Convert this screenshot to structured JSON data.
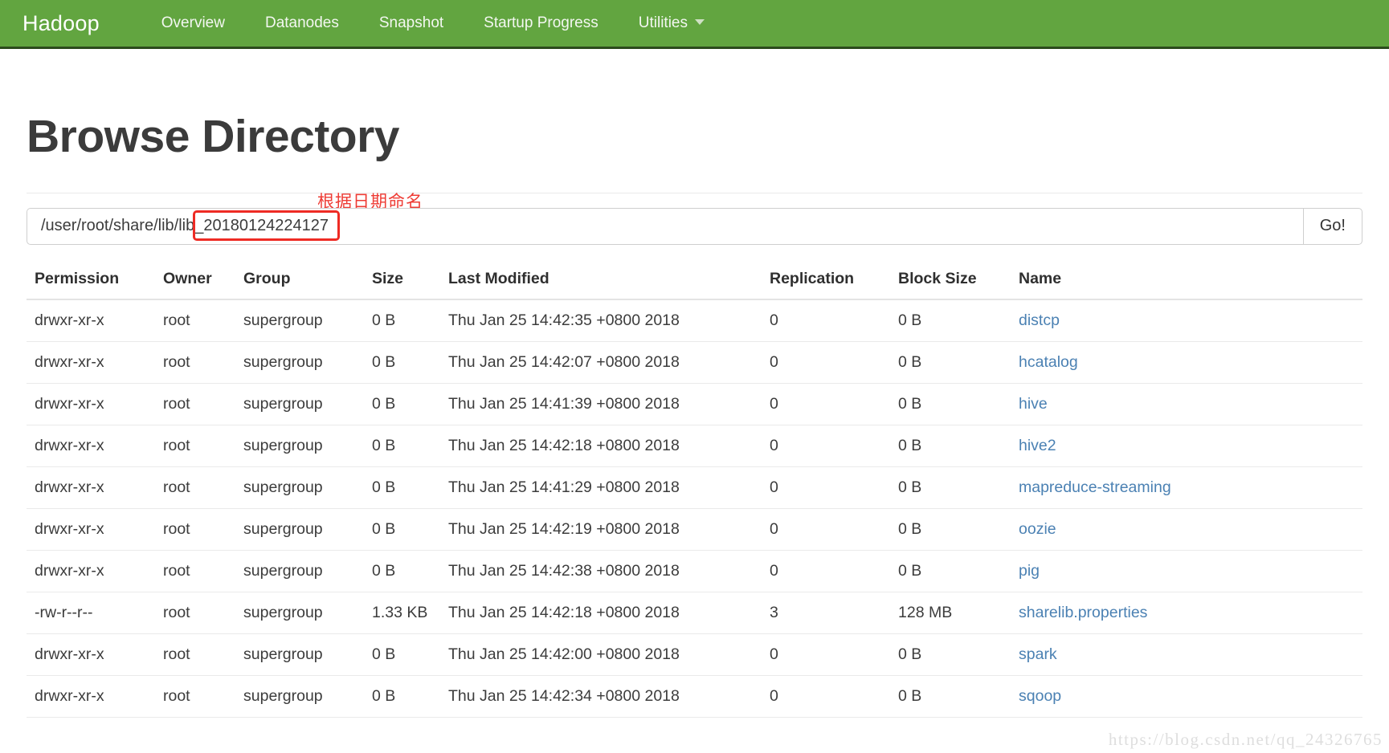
{
  "navbar": {
    "brand": "Hadoop",
    "accent_color": "#62a540",
    "items": [
      {
        "label": "Overview",
        "caret": false
      },
      {
        "label": "Datanodes",
        "caret": false
      },
      {
        "label": "Snapshot",
        "caret": false
      },
      {
        "label": "Startup Progress",
        "caret": false
      },
      {
        "label": "Utilities",
        "caret": true
      }
    ]
  },
  "page": {
    "title": "Browse Directory",
    "annotation": "根据日期命名",
    "annotation_color": "#ee3b34",
    "watermark": "https://blog.csdn.net/qq_24326765"
  },
  "path_bar": {
    "value": "/user/root/share/lib/lib_20180124224127",
    "placeholder": "Enter path",
    "highlighted_segment": "lib_20180124224127",
    "highlight_color": "#ee2b24",
    "go_label": "Go!"
  },
  "table": {
    "headers": [
      "Permission",
      "Owner",
      "Group",
      "Size",
      "Last Modified",
      "Replication",
      "Block Size",
      "Name"
    ],
    "rows": [
      {
        "permission": "drwxr-xr-x",
        "owner": "root",
        "group": "supergroup",
        "size": "0 B",
        "modified": "Thu Jan 25 14:42:35 +0800 2018",
        "replication": "0",
        "block_size": "0 B",
        "name": "distcp"
      },
      {
        "permission": "drwxr-xr-x",
        "owner": "root",
        "group": "supergroup",
        "size": "0 B",
        "modified": "Thu Jan 25 14:42:07 +0800 2018",
        "replication": "0",
        "block_size": "0 B",
        "name": "hcatalog"
      },
      {
        "permission": "drwxr-xr-x",
        "owner": "root",
        "group": "supergroup",
        "size": "0 B",
        "modified": "Thu Jan 25 14:41:39 +0800 2018",
        "replication": "0",
        "block_size": "0 B",
        "name": "hive"
      },
      {
        "permission": "drwxr-xr-x",
        "owner": "root",
        "group": "supergroup",
        "size": "0 B",
        "modified": "Thu Jan 25 14:42:18 +0800 2018",
        "replication": "0",
        "block_size": "0 B",
        "name": "hive2"
      },
      {
        "permission": "drwxr-xr-x",
        "owner": "root",
        "group": "supergroup",
        "size": "0 B",
        "modified": "Thu Jan 25 14:41:29 +0800 2018",
        "replication": "0",
        "block_size": "0 B",
        "name": "mapreduce-streaming"
      },
      {
        "permission": "drwxr-xr-x",
        "owner": "root",
        "group": "supergroup",
        "size": "0 B",
        "modified": "Thu Jan 25 14:42:19 +0800 2018",
        "replication": "0",
        "block_size": "0 B",
        "name": "oozie"
      },
      {
        "permission": "drwxr-xr-x",
        "owner": "root",
        "group": "supergroup",
        "size": "0 B",
        "modified": "Thu Jan 25 14:42:38 +0800 2018",
        "replication": "0",
        "block_size": "0 B",
        "name": "pig"
      },
      {
        "permission": "-rw-r--r--",
        "owner": "root",
        "group": "supergroup",
        "size": "1.33 KB",
        "modified": "Thu Jan 25 14:42:18 +0800 2018",
        "replication": "3",
        "block_size": "128 MB",
        "name": "sharelib.properties"
      },
      {
        "permission": "drwxr-xr-x",
        "owner": "root",
        "group": "supergroup",
        "size": "0 B",
        "modified": "Thu Jan 25 14:42:00 +0800 2018",
        "replication": "0",
        "block_size": "0 B",
        "name": "spark"
      },
      {
        "permission": "drwxr-xr-x",
        "owner": "root",
        "group": "supergroup",
        "size": "0 B",
        "modified": "Thu Jan 25 14:42:34 +0800 2018",
        "replication": "0",
        "block_size": "0 B",
        "name": "sqoop"
      }
    ]
  }
}
